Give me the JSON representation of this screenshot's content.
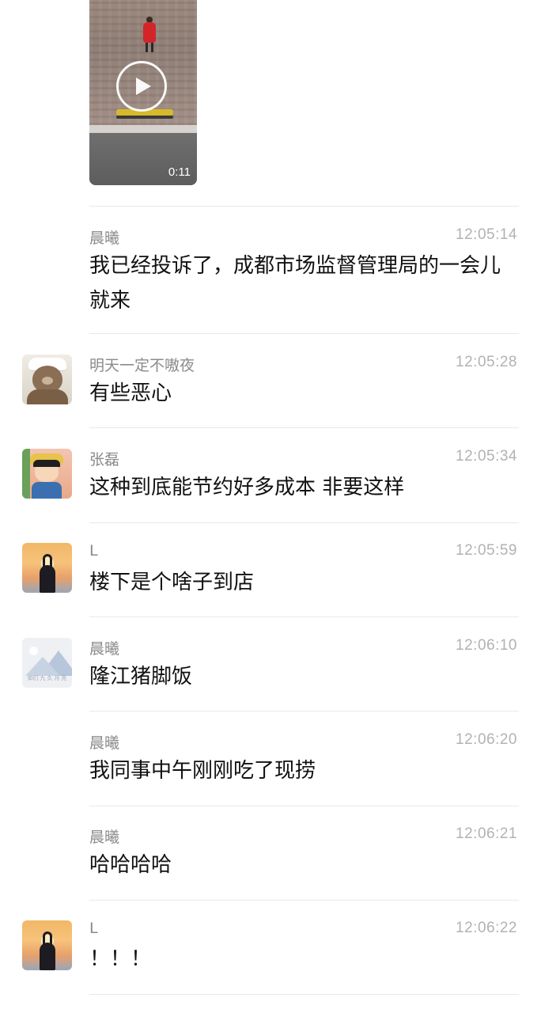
{
  "video": {
    "duration": "0:11"
  },
  "messages": [
    {
      "name": "晨曦",
      "time": "12:05:14",
      "text": "我已经投诉了，成都市场监督管理局的一会儿就来"
    },
    {
      "name": "明天一定不嗷夜",
      "time": "12:05:28",
      "text": "有些恶心",
      "avatar": "bear-avatar"
    },
    {
      "name": "张磊",
      "time": "12:05:34",
      "text": "这种到底能节约好多成本 非要这样",
      "avatar": "anime-avatar"
    },
    {
      "name": "L",
      "time": "12:05:59",
      "text": "楼下是个啥子到店",
      "avatar": "sunset-avatar"
    },
    {
      "name": "晨曦",
      "time": "12:06:10",
      "text": "隆江猪脚饭",
      "avatar": "placeholder-avatar",
      "avatar_caption": "如们 九 久 月 亮"
    },
    {
      "name": "晨曦",
      "time": "12:06:20",
      "text": "我同事中午刚刚吃了现捞"
    },
    {
      "name": "晨曦",
      "time": "12:06:21",
      "text": "哈哈哈哈"
    },
    {
      "name": "L",
      "time": "12:06:22",
      "text": "！！！",
      "avatar": "sunset-avatar"
    }
  ]
}
